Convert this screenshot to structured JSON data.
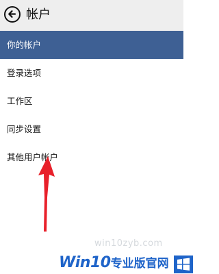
{
  "header": {
    "title": "帐户"
  },
  "nav": {
    "items": [
      {
        "label": "你的帐户",
        "selected": true
      },
      {
        "label": "登录选项",
        "selected": false
      },
      {
        "label": "工作区",
        "selected": false
      },
      {
        "label": "同步设置",
        "selected": false
      },
      {
        "label": "其他用户帐户",
        "selected": false
      }
    ]
  },
  "watermark": {
    "url": "win10zyb.com",
    "brand_win": "Win10",
    "brand_cn": "专业版官网"
  },
  "colors": {
    "selected_bg": "#3e6094",
    "header_bg": "#eeeeee",
    "arrow": "#e8202a",
    "brand": "#1f64c9"
  }
}
